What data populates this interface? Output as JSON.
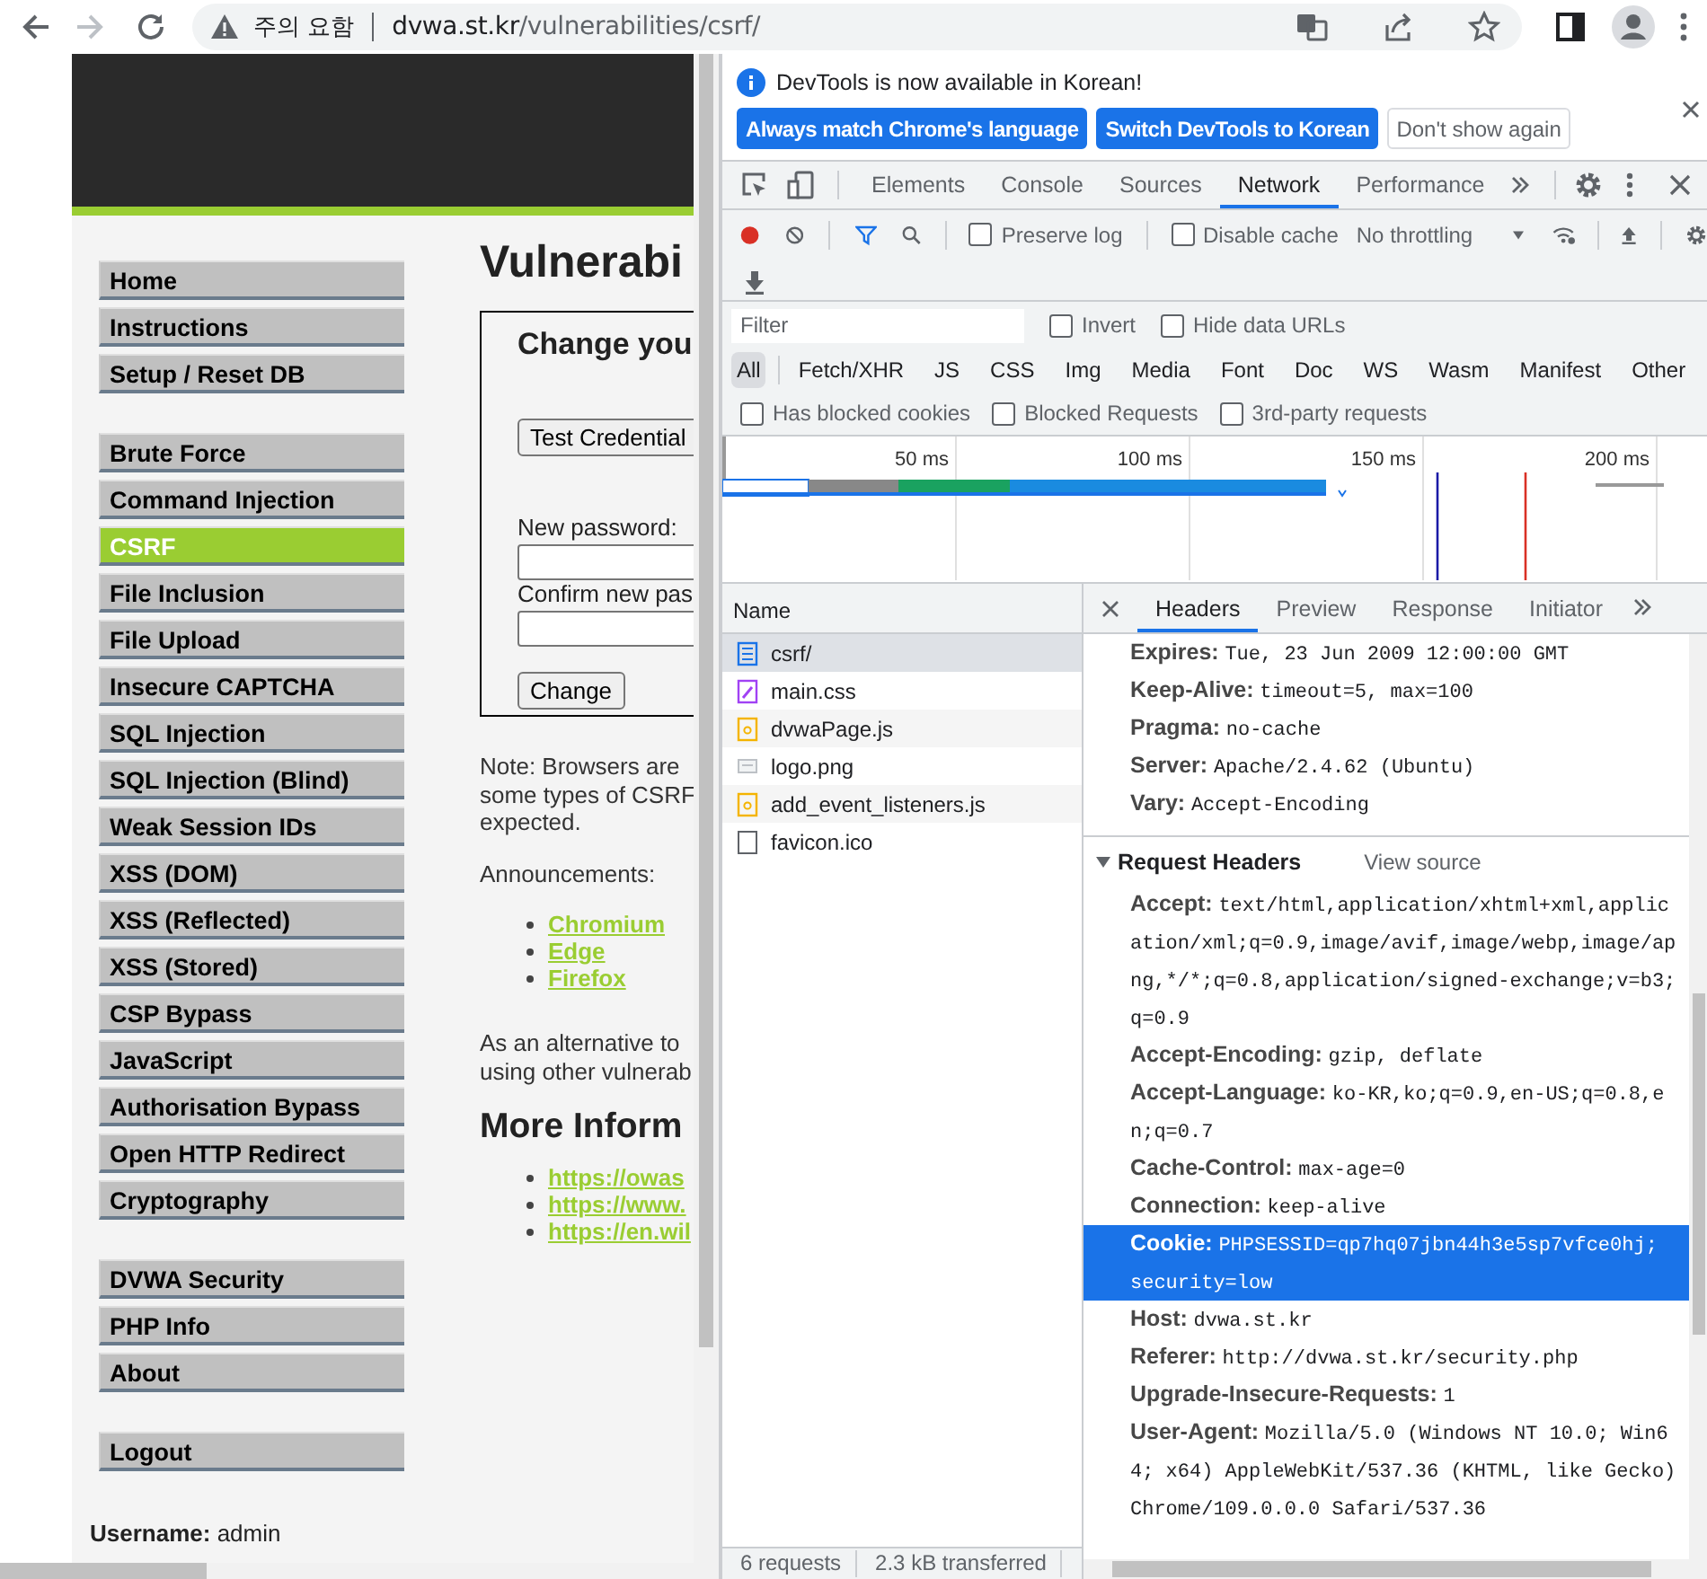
{
  "browser": {
    "security_label": "주의 요함",
    "url_host": "dvwa.st.kr",
    "url_path": "/vulnerabilities/csrf/"
  },
  "page": {
    "menu_groups": [
      {
        "items": [
          {
            "label": "Home",
            "selected": false
          },
          {
            "label": "Instructions",
            "selected": false
          },
          {
            "label": "Setup / Reset DB",
            "selected": false
          }
        ]
      },
      {
        "items": [
          {
            "label": "Brute Force",
            "selected": false
          },
          {
            "label": "Command Injection",
            "selected": false
          },
          {
            "label": "CSRF",
            "selected": true
          },
          {
            "label": "File Inclusion",
            "selected": false
          },
          {
            "label": "File Upload",
            "selected": false
          },
          {
            "label": "Insecure CAPTCHA",
            "selected": false
          },
          {
            "label": "SQL Injection",
            "selected": false
          },
          {
            "label": "SQL Injection (Blind)",
            "selected": false
          },
          {
            "label": "Weak Session IDs",
            "selected": false
          },
          {
            "label": "XSS (DOM)",
            "selected": false
          },
          {
            "label": "XSS (Reflected)",
            "selected": false
          },
          {
            "label": "XSS (Stored)",
            "selected": false
          },
          {
            "label": "CSP Bypass",
            "selected": false
          },
          {
            "label": "JavaScript",
            "selected": false
          },
          {
            "label": "Authorisation Bypass",
            "selected": false
          },
          {
            "label": "Open HTTP Redirect",
            "selected": false
          },
          {
            "label": "Cryptography",
            "selected": false
          }
        ]
      },
      {
        "items": [
          {
            "label": "DVWA Security",
            "selected": false
          },
          {
            "label": "PHP Info",
            "selected": false
          },
          {
            "label": "About",
            "selected": false
          }
        ]
      },
      {
        "items": [
          {
            "label": "Logout",
            "selected": false
          }
        ]
      }
    ],
    "title": "Vulnerabi",
    "form": {
      "heading": "Change you",
      "test_button": "Test Credential",
      "new_password_label": "New password:",
      "confirm_password_label": "Confirm new pas",
      "submit_button": "Change"
    },
    "note_lines": [
      "Note: Browsers are",
      "some types of CSRF",
      "expected."
    ],
    "announcements_label": "Announcements:",
    "announcement_links": [
      "Chromium",
      "Edge",
      "Firefox"
    ],
    "alternative_lines": [
      "As an alternative to",
      "using other vulnerab"
    ],
    "more_info_heading": "More Inform",
    "more_info_links": [
      "https://owas",
      "https://www.",
      "https://en.wil"
    ],
    "username_line": "**Username:** admin"
  },
  "devtools": {
    "infobar": {
      "message": "DevTools is now available in Korean!",
      "buttons": [
        {
          "label": "Always match Chrome's language",
          "kind": "primary"
        },
        {
          "label": "Switch DevTools to Korean",
          "kind": "primary"
        },
        {
          "label": "Don't show again",
          "kind": "secondary"
        }
      ]
    },
    "tabs": [
      {
        "label": "Elements",
        "selected": false
      },
      {
        "label": "Console",
        "selected": false
      },
      {
        "label": "Sources",
        "selected": false
      },
      {
        "label": "Network",
        "selected": true
      },
      {
        "label": "Performance",
        "selected": false
      }
    ],
    "toolbar": {
      "preserve_log": {
        "label": "Preserve log",
        "checked": false
      },
      "disable_cache": {
        "label": "Disable cache",
        "checked": false
      },
      "throttling": "No throttling"
    },
    "filter": {
      "placeholder": "Filter",
      "invert": {
        "label": "Invert",
        "checked": false
      },
      "hide_data_urls": {
        "label": "Hide data URLs",
        "checked": false
      }
    },
    "types": [
      {
        "label": "All",
        "selected": true
      },
      {
        "label": "Fetch/XHR",
        "selected": false
      },
      {
        "label": "JS",
        "selected": false
      },
      {
        "label": "CSS",
        "selected": false
      },
      {
        "label": "Img",
        "selected": false
      },
      {
        "label": "Media",
        "selected": false
      },
      {
        "label": "Font",
        "selected": false
      },
      {
        "label": "Doc",
        "selected": false
      },
      {
        "label": "WS",
        "selected": false
      },
      {
        "label": "Wasm",
        "selected": false
      },
      {
        "label": "Manifest",
        "selected": false
      },
      {
        "label": "Other",
        "selected": false
      }
    ],
    "more_filters": [
      {
        "label": "Has blocked cookies",
        "checked": false
      },
      {
        "label": "Blocked Requests",
        "checked": false
      },
      {
        "label": "3rd-party requests",
        "checked": false
      }
    ],
    "overview_ticks": [
      "50 ms",
      "100 ms",
      "150 ms",
      "200 ms"
    ],
    "name_column": "Name",
    "requests": [
      {
        "name": "csrf/",
        "kind": "document",
        "selected": true
      },
      {
        "name": "main.css",
        "kind": "stylesheet",
        "selected": false
      },
      {
        "name": "dvwaPage.js",
        "kind": "script",
        "selected": false
      },
      {
        "name": "logo.png",
        "kind": "image",
        "selected": false
      },
      {
        "name": "add_event_listeners.js",
        "kind": "script",
        "selected": false
      },
      {
        "name": "favicon.ico",
        "kind": "other",
        "selected": false
      }
    ],
    "summary": [
      "6 requests",
      "2.3 kB transferred"
    ],
    "detail_tabs": [
      {
        "label": "Headers",
        "selected": true
      },
      {
        "label": "Preview",
        "selected": false
      },
      {
        "label": "Response",
        "selected": false
      },
      {
        "label": "Initiator",
        "selected": false
      }
    ],
    "response_headers": [
      {
        "name": "Expires:",
        "value": "Tue, 23 Jun 2009 12:00:00 GMT",
        "selected": false
      },
      {
        "name": "Keep-Alive:",
        "value": "timeout=5, max=100",
        "selected": false
      },
      {
        "name": "Pragma:",
        "value": "no-cache",
        "selected": false
      },
      {
        "name": "Server:",
        "value": "Apache/2.4.62 (Ubuntu)",
        "selected": false
      },
      {
        "name": "Vary:",
        "value": "Accept-Encoding",
        "selected": false
      }
    ],
    "request_section": {
      "title": "Request Headers",
      "action": "View source",
      "expanded": true
    },
    "request_headers": [
      {
        "name": "Accept:",
        "value": "text/html,application/xhtml+xml,application/xml;q=0.9,image/avif,image/webp,image/apng,*/*;q=0.8,application/signed-exchange;v=b3;q=0.9",
        "selected": false
      },
      {
        "name": "Accept-Encoding:",
        "value": "gzip, deflate",
        "selected": false
      },
      {
        "name": "Accept-Language:",
        "value": "ko-KR,ko;q=0.9,en-US;q=0.8,en;q=0.7",
        "selected": false
      },
      {
        "name": "Cache-Control:",
        "value": "max-age=0",
        "selected": false
      },
      {
        "name": "Connection:",
        "value": "keep-alive",
        "selected": false
      },
      {
        "name": "Cookie:",
        "value": "PHPSESSID=qp7hq07jbn44h3e5sp7vfce0hj; security=low",
        "selected": true
      },
      {
        "name": "Host:",
        "value": "dvwa.st.kr",
        "selected": false
      },
      {
        "name": "Referer:",
        "value": "http://dvwa.st.kr/security.php",
        "selected": false
      },
      {
        "name": "Upgrade-Insecure-Requests:",
        "value": "1",
        "selected": false
      },
      {
        "name": "User-Agent:",
        "value": "Mozilla/5.0 (Windows NT 10.0; Win64; x64) AppleWebKit/537.36 (KHTML, like Gecko) Chrome/109.0.0.0 Safari/537.36",
        "selected": false
      }
    ]
  }
}
